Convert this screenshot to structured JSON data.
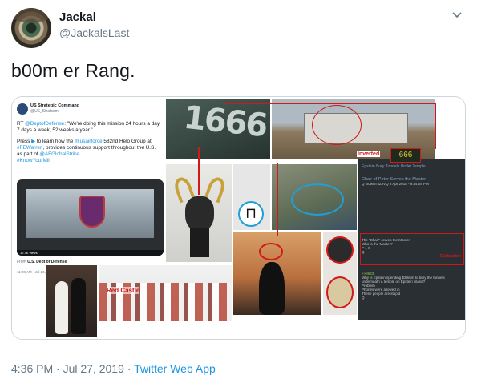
{
  "tweet": {
    "name": "Jackal",
    "handle": "@JackalsLast",
    "text": "b00m er Rang.",
    "timestamp": "4:36 PM",
    "separator": "·",
    "date": "Jul 27, 2019",
    "source": "Twitter Web App",
    "colors": {
      "link": "#1b95e0",
      "muted": "#657786",
      "highlight": "#d01919"
    }
  },
  "media": {
    "embedded": {
      "name": "US Strategic Command",
      "handle": "@US_Stratcom",
      "line1_prefix": "RT ",
      "line1_link": "@DeptofDefense",
      "line1_rest": ": \"We're doing this mission 24 hours a day, 7 days a week, 52 weeks a year.\"",
      "line2_prefix": "Press ",
      "line2_play": "▶",
      "line2_mid": " to learn how the ",
      "line2_link1": "@usairforce",
      "line2_mid2": " 582nd Helo Group at ",
      "line2_link2": "#FEWarren",
      "line2_rest": ", provides continuous support throughout the U.S. as part of ",
      "line2_link3": "@AFGlobalStrike",
      "line2_end": ".",
      "line3_link": "#KnowYourMil",
      "video_views": "12.7K views",
      "from_prefix": "From ",
      "from_source": "U.S. Dept of Defense",
      "time": "11:20 AM - Jul 26, 2019 - Hootsuite Inc."
    },
    "number": "1666",
    "labels": {
      "inverted": "Inverted",
      "six": "666",
      "red_castle": "Red Castle",
      "checkmate": "Civilization"
    },
    "chan": {
      "header": "Epstein Bury Tunnels Under Temple",
      "posts": [
        {
          "title": "Chair of Peter Serves the Master",
          "meta": "Q !xowAT4Z3VQ 5 Apr 2018 - 9:44:09 PM"
        },
        {
          "lines": [
            "The \"Chair\" serves the Master.",
            "Who is the Master?",
            "P = C",
            "Q"
          ]
        },
        {
          "lines": [
            ">>8633",
            "Why is Epstein spending $29mm to bury the tunnels underneath a temple on Epstein island?",
            "Problem",
            "Phones were allowed in",
            "These people are stupid",
            "Q"
          ]
        }
      ]
    }
  }
}
